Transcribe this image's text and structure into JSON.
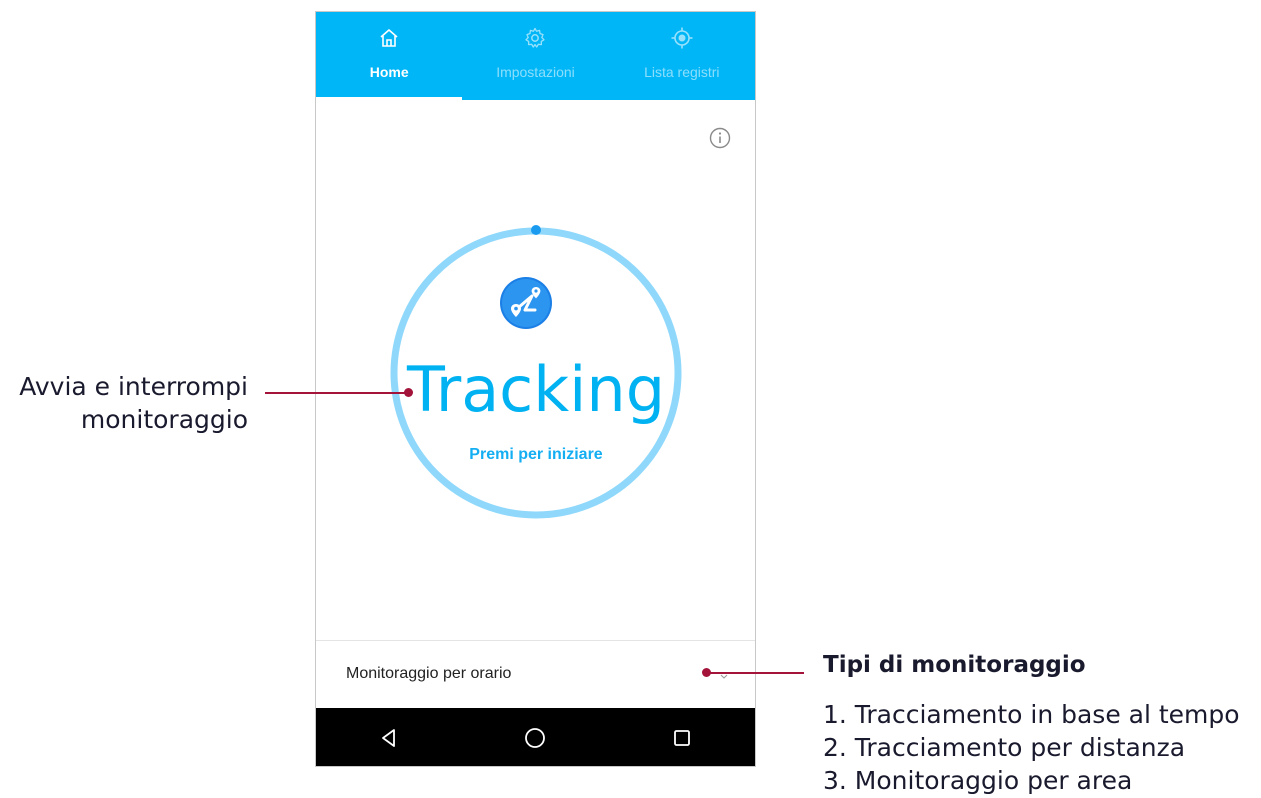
{
  "tabs": [
    {
      "label": "Home",
      "icon": "home-icon",
      "active": true
    },
    {
      "label": "Impostazioni",
      "icon": "gear-icon",
      "active": false
    },
    {
      "label": "Lista registri",
      "icon": "location-target-icon",
      "active": false
    }
  ],
  "tracking": {
    "title": "Tracking",
    "subtitle": "Premi per iniziare"
  },
  "mode": {
    "selected": "Monitoraggio per orario"
  },
  "navigation": [
    "back-icon",
    "home-circle-icon",
    "recents-square-icon"
  ],
  "annotations": {
    "left_line1": "Avvia e interrompi",
    "left_line2": "monitoraggio",
    "right_title": "Tipi di monitoraggio",
    "right_items": [
      "1. Tracciamento in base al tempo",
      "2. Tracciamento per distanza",
      "3. Monitoraggio per area"
    ]
  },
  "colors": {
    "primary": "#00b6f7",
    "ring": "#8fd8fb",
    "callout": "#a3133a"
  }
}
